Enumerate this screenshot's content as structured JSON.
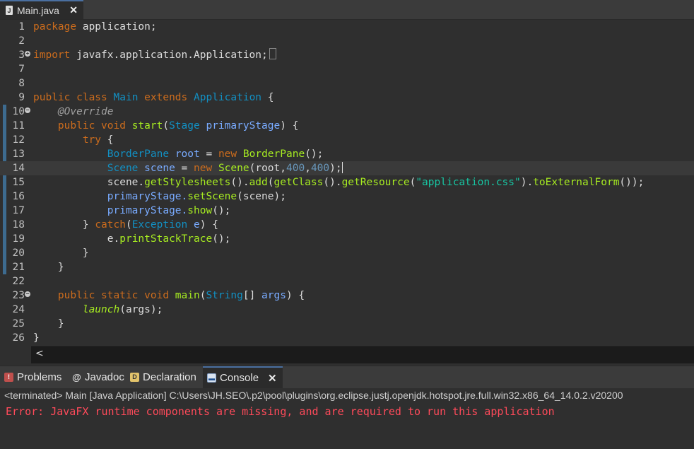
{
  "editor_tab": {
    "label": "Main.java",
    "close": "✕"
  },
  "lines": [
    {
      "n": "1"
    },
    {
      "n": "2"
    },
    {
      "n": "3"
    },
    {
      "n": "7"
    },
    {
      "n": "8"
    },
    {
      "n": "9"
    },
    {
      "n": "10"
    },
    {
      "n": "11"
    },
    {
      "n": "12"
    },
    {
      "n": "13"
    },
    {
      "n": "14"
    },
    {
      "n": "15"
    },
    {
      "n": "16"
    },
    {
      "n": "17"
    },
    {
      "n": "18"
    },
    {
      "n": "19"
    },
    {
      "n": "20"
    },
    {
      "n": "21"
    },
    {
      "n": "22"
    },
    {
      "n": "23"
    },
    {
      "n": "24"
    },
    {
      "n": "25"
    },
    {
      "n": "26"
    }
  ],
  "code": {
    "l1_kw": "package",
    "l1_rest": " application;",
    "l3_kw": "import",
    "l3_rest": " javafx.application.Application;",
    "l9_kw1": "public class",
    "l9_cls": "Main",
    "l9_kw2": "extends",
    "l9_sup": "Application",
    "l9_end": " {",
    "l10_ann": "@Override",
    "l11_kw": "public void",
    "l11_fn": "start",
    "l11_p1": "(",
    "l11_ty": "Stage",
    "l11_var": "primaryStage",
    "l11_end": ") {",
    "l12_kw": "try",
    "l12_end": " {",
    "l13_ty": "BorderPane",
    "l13_var": "root",
    "l13_eq": " = ",
    "l13_kw": "new",
    "l13_fn": "BorderPane",
    "l13_end": "();",
    "l14_ty": "Scene",
    "l14_var": "scene",
    "l14_eq": " = ",
    "l14_kw": "new",
    "l14_fn": "Scene",
    "l14_p": "(root,",
    "l14_n1": "400",
    "l14_c": ",",
    "l14_n2": "400",
    "l14_end": ");",
    "l15_a": "scene.",
    "l15_f1": "getStylesheets",
    "l15_b": "().",
    "l15_f2": "add",
    "l15_c": "(",
    "l15_f3": "getClass",
    "l15_d": "().",
    "l15_f4": "getResource",
    "l15_e": "(",
    "l15_str": "\"application.css\"",
    "l15_g": ").",
    "l15_f5": "toExternalForm",
    "l15_end": "());",
    "l16_a": "primaryStage.",
    "l16_f": "setScene",
    "l16_end": "(scene);",
    "l17_a": "primaryStage.",
    "l17_f": "show",
    "l17_end": "();",
    "l18_a": "} ",
    "l18_kw": "catch",
    "l18_p": "(",
    "l18_ty": "Exception",
    "l18_var": "e",
    "l18_end": ") {",
    "l19_a": "e.",
    "l19_f": "printStackTrace",
    "l19_end": "();",
    "l20": "}",
    "l21": "}",
    "l23_kw": "public static void",
    "l23_fn": "main",
    "l23_p": "(",
    "l23_ty": "String",
    "l23_arr": "[] ",
    "l23_var": "args",
    "l23_end": ") {",
    "l24_fn": "launch",
    "l24_end": "(args);",
    "l25": "}",
    "l26": "}"
  },
  "panel_tabs": {
    "problems": "Problems",
    "javadoc": "Javadoc",
    "declaration": "Declaration",
    "console": "Console",
    "close": "✕"
  },
  "console": {
    "status": "<terminated> Main [Java Application] C:\\Users\\JH.SEO\\.p2\\pool\\plugins\\org.eclipse.justj.openjdk.hotspot.jre.full.win32.x86_64_14.0.2.v20200",
    "error": "Error: JavaFX runtime components are missing, and are required to run this application"
  },
  "icons": {
    "file": "java-file-icon",
    "problems": "problems-icon",
    "javadoc": "javadoc-icon",
    "declaration": "declaration-icon",
    "console": "console-icon"
  },
  "colors": {
    "keyword": "#cc6c1d",
    "type": "#1290c3",
    "method": "#a7ec21",
    "variable": "#79abff",
    "string": "#17c6a3",
    "error": "#ff4a5a",
    "background": "#2f2f2f"
  }
}
